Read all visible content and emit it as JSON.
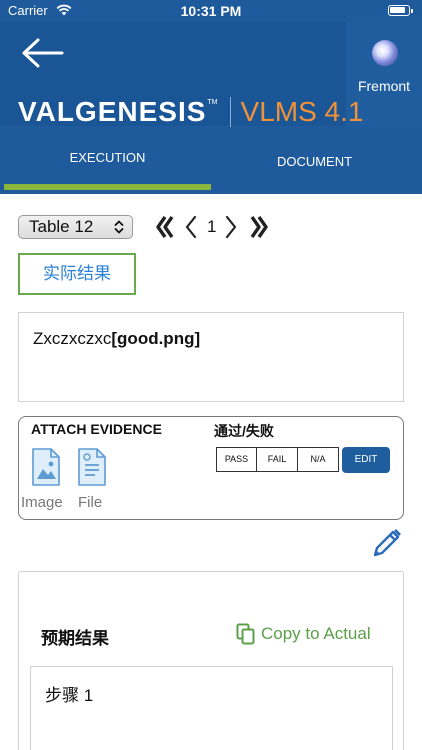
{
  "status_bar": {
    "carrier": "Carrier",
    "time": "10:31 PM"
  },
  "header": {
    "user_name": "Fremont",
    "brand": "VALGENESIS",
    "product": "VLMS 4.1",
    "tabs": [
      {
        "label": "EXECUTION",
        "active": true
      },
      {
        "label": "DOCUMENT",
        "active": false
      }
    ]
  },
  "toolbar": {
    "table_select_value": "Table 12",
    "page_number": "1"
  },
  "actual_result": {
    "button_label": "实际结果",
    "text": "Zxczxczxc",
    "attachment": "[good.png]"
  },
  "evidence": {
    "title": "ATTACH EVIDENCE",
    "pass_fail_title": "通过/失败",
    "image_label": "Image",
    "file_label": "File",
    "pass_label": "PASS",
    "fail_label": "FAIL",
    "na_label": "N/A",
    "edit_label": "EDIT"
  },
  "expected": {
    "title": "预期结果",
    "copy_label": "Copy to Actual",
    "step_text": "步骤 1"
  },
  "colors": {
    "header_blue": "#1e5a9c",
    "tab_indicator": "#8ab63c",
    "brand_orange": "#f0923a",
    "link_blue": "#2b82d9",
    "copy_green": "#5aa04a",
    "edit_blue": "#1e5e9f"
  },
  "icons": {
    "back": "arrow-left-icon",
    "avatar": "avatar",
    "image": "image-icon",
    "file": "file-icon",
    "pencil": "pencil-icon",
    "copy": "copy-icon"
  }
}
